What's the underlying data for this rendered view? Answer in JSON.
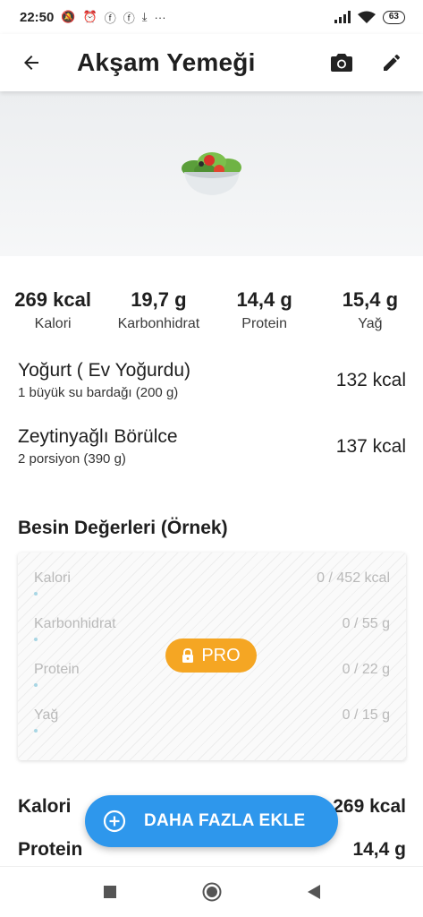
{
  "status_bar": {
    "time": "22:50",
    "dots": "···",
    "battery": "63"
  },
  "header": {
    "title": "Akşam Yemeği"
  },
  "summary": [
    {
      "value": "269 kcal",
      "label": "Kalori"
    },
    {
      "value": "19,7 g",
      "label": "Karbonhidrat"
    },
    {
      "value": "14,4 g",
      "label": "Protein"
    },
    {
      "value": "15,4 g",
      "label": "Yağ"
    }
  ],
  "foods": [
    {
      "name": "Yoğurt ( Ev Yoğurdu)",
      "portion": "1 büyük su bardağı (200 g)",
      "kcal": "132 kcal"
    },
    {
      "name": "Zeytinyağlı Börülce",
      "portion": "2 porsiyon (390 g)",
      "kcal": "137 kcal"
    }
  ],
  "nutrition": {
    "title": "Besin Değerleri (Örnek)",
    "rows": [
      {
        "label": "Kalori",
        "value": "0 / 452 kcal",
        "progress": 0
      },
      {
        "label": "Karbonhidrat",
        "value": "0 / 55 g",
        "progress": 0
      },
      {
        "label": "Protein",
        "value": "0 / 22 g",
        "progress": 0
      },
      {
        "label": "Yağ",
        "value": "0 / 15 g",
        "progress": 0
      }
    ],
    "pro_label": "PRO"
  },
  "totals": [
    {
      "label": "Kalori",
      "value": "269 kcal"
    },
    {
      "label": "Protein",
      "value": "14,4 g"
    }
  ],
  "fab": {
    "label": "DAHA FAZLA EKLE"
  },
  "colors": {
    "accent": "#2e97ec",
    "pro": "#f5a623",
    "bar": "#a8d6e4"
  }
}
